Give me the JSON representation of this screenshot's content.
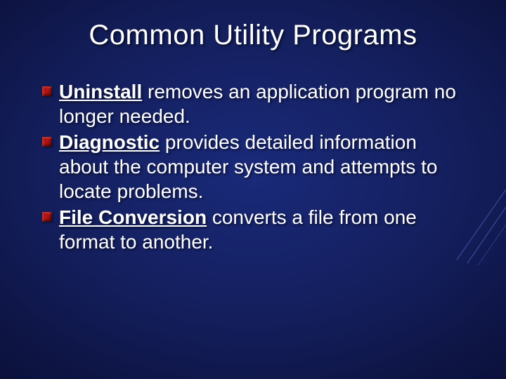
{
  "title": "Common Utility Programs",
  "items": [
    {
      "term": "Uninstall",
      "rest": " removes an application program no longer needed."
    },
    {
      "term": "Diagnostic",
      "rest": " provides detailed information about the computer system and attempts to locate problems."
    },
    {
      "term": "File Conversion",
      "rest": " converts a file from one format to another."
    }
  ]
}
